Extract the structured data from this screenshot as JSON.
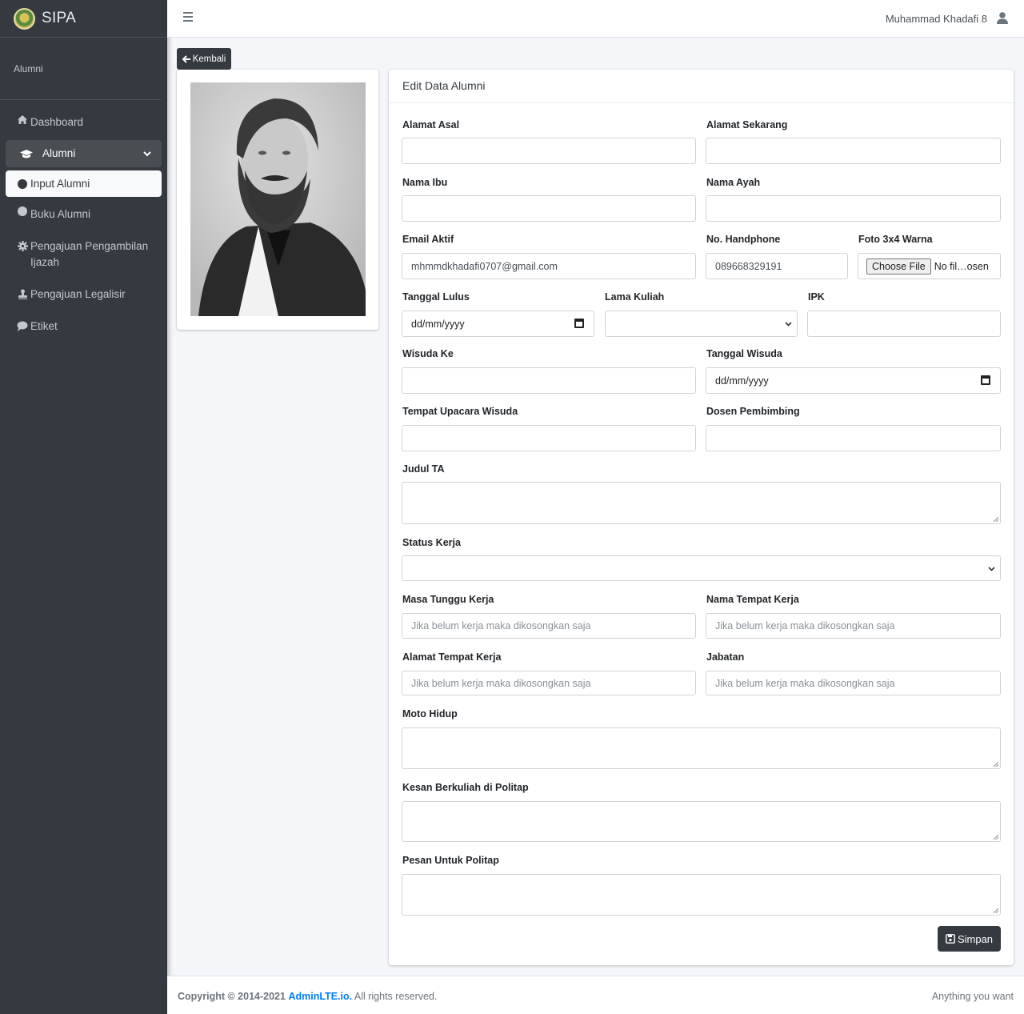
{
  "brand": {
    "name": "SIPA"
  },
  "user_panel": {
    "label": "Alumni"
  },
  "sidebar": {
    "items": [
      {
        "label": "Dashboard",
        "icon": "home-icon"
      },
      {
        "label": "Alumni",
        "icon": "graduation-cap-icon"
      },
      {
        "label": "Input Alumni",
        "icon": "circle-icon"
      },
      {
        "label": "Buku Alumni",
        "icon": "circle-icon"
      },
      {
        "label": "Pengajuan Pengambilan Ijazah",
        "icon": "gear-icon"
      },
      {
        "label": "Pengajuan Legalisir",
        "icon": "stamp-icon"
      },
      {
        "label": "Etiket",
        "icon": "comment-icon"
      }
    ]
  },
  "header": {
    "user_name": "Muhammad Khadafi 8"
  },
  "back_button": {
    "label": "Kembali"
  },
  "form": {
    "title": "Edit Data Alumni",
    "alamat_asal": {
      "label": "Alamat Asal",
      "value": ""
    },
    "alamat_sekarang": {
      "label": "Alamat Sekarang",
      "value": ""
    },
    "nama_ibu": {
      "label": "Nama Ibu",
      "value": ""
    },
    "nama_ayah": {
      "label": "Nama Ayah",
      "value": ""
    },
    "email": {
      "label": "Email Aktif",
      "value": "mhmmdkhadafi0707@gmail.com"
    },
    "handphone": {
      "label": "No. Handphone",
      "value": "089668329191"
    },
    "foto": {
      "label": "Foto 3x4 Warna",
      "button": "Choose File",
      "status": "No fil…osen"
    },
    "tanggal_lulus": {
      "label": "Tanggal Lulus",
      "value": "dd/mm/yyyy"
    },
    "lama_kuliah": {
      "label": "Lama Kuliah",
      "value": ""
    },
    "ipk": {
      "label": "IPK",
      "value": ""
    },
    "wisuda_ke": {
      "label": "Wisuda Ke",
      "value": ""
    },
    "tanggal_wisuda": {
      "label": "Tanggal Wisuda",
      "value": "dd/mm/yyyy"
    },
    "tempat_upacara": {
      "label": "Tempat Upacara Wisuda",
      "value": ""
    },
    "dosen_pembimbing": {
      "label": "Dosen Pembimbing",
      "value": ""
    },
    "judul_ta": {
      "label": "Judul TA"
    },
    "status_kerja": {
      "label": "Status Kerja",
      "value": ""
    },
    "masa_tunggu": {
      "label": "Masa Tunggu Kerja",
      "placeholder": "Jika belum kerja maka dikosongkan saja"
    },
    "nama_tempat_kerja": {
      "label": "Nama Tempat Kerja",
      "placeholder": "Jika belum kerja maka dikosongkan saja"
    },
    "alamat_tempat_kerja": {
      "label": "Alamat Tempat Kerja",
      "placeholder": "Jika belum kerja maka dikosongkan saja"
    },
    "jabatan": {
      "label": "Jabatan",
      "placeholder": "Jika belum kerja maka dikosongkan saja"
    },
    "moto_hidup": {
      "label": "Moto Hidup"
    },
    "kesan": {
      "label": "Kesan Berkuliah di Politap"
    },
    "pesan": {
      "label": "Pesan Untuk Politap"
    },
    "save_label": "Simpan"
  },
  "footer": {
    "copyright_prefix": "Copyright © 2014-2021",
    "link": "AdminLTE.io.",
    "suffix": "All rights reserved.",
    "right": "Anything you want"
  }
}
